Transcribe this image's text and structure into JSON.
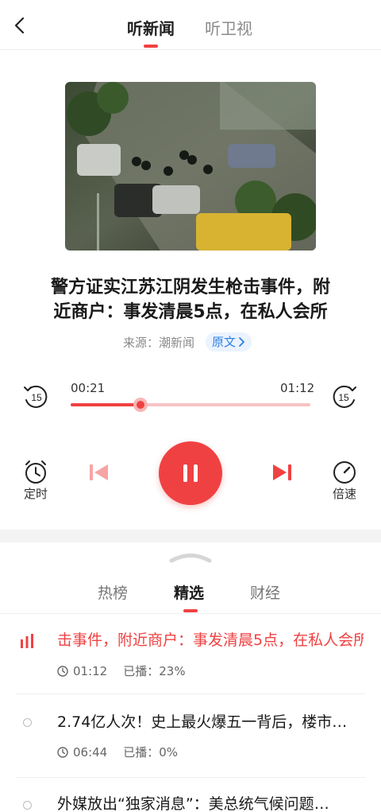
{
  "header": {
    "tabs": [
      {
        "label": "听新闻",
        "active": true
      },
      {
        "label": "听卫视",
        "active": false
      }
    ]
  },
  "article": {
    "title_line1": "警方证实江苏江阴发生枪击事件，附",
    "title_line2": "近商户：事发清晨5点，在私人会所",
    "source": "来源：潮新闻",
    "original_label": "原文"
  },
  "player": {
    "current_time": "00:21",
    "total_time": "01:12",
    "progress": 0.29,
    "skip_back": "15",
    "skip_forward": "15",
    "timer_label": "定时",
    "speed_label": "倍速",
    "state": "playing"
  },
  "list": {
    "tabs": [
      {
        "label": "热榜",
        "active": false
      },
      {
        "label": "精选",
        "active": true
      },
      {
        "label": "财经",
        "active": false
      }
    ],
    "items": [
      {
        "title": "击事件，附近商户：事发清晨5点，在私人会所",
        "duration": "01:12",
        "played": "已播：23%",
        "playing": true
      },
      {
        "title": "2.74亿人次！史上最火爆五一背后，楼市…",
        "duration": "06:44",
        "played": "已播：0%",
        "playing": false
      },
      {
        "title": "外媒放出“独家消息”：美总统气候问题…",
        "playing": false
      }
    ]
  },
  "colors": {
    "accent": "#f04142",
    "accent_light": "#f7c3c3",
    "link": "#2d7fe0"
  }
}
